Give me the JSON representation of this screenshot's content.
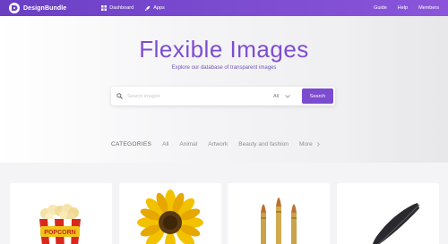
{
  "nav": {
    "brand": "DesignBundle",
    "links_left": [
      {
        "label": "Dashboard",
        "icon": "dashboard-icon"
      },
      {
        "label": "Apps",
        "icon": "rocket-icon"
      }
    ],
    "links_right": [
      "Guide",
      "Help",
      "Members"
    ]
  },
  "hero": {
    "title": "Flexible Images",
    "subtitle": "Explore our database of transparent images"
  },
  "search": {
    "placeholder": "Search images",
    "select_value": "All",
    "button": "Search"
  },
  "categories": {
    "label": "CATEGORIES",
    "items": [
      "All",
      "Animal",
      "Artwork",
      "Beauty and fashion"
    ],
    "more": "More"
  },
  "cards": [
    {
      "name": "popcorn",
      "text": "POPCORN"
    },
    {
      "name": "sunflower"
    },
    {
      "name": "bullets"
    },
    {
      "name": "feather"
    }
  ],
  "colors": {
    "accent": "#7b4bd0",
    "nav": "#6a3fc4"
  }
}
